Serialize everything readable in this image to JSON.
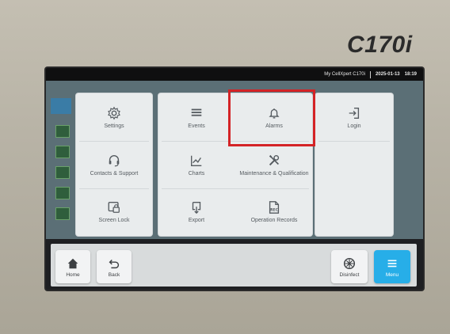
{
  "device": {
    "model": "C170i"
  },
  "statusbar": {
    "device_name": "My CellXpert C170i",
    "date": "2025-01-13",
    "time": "18:19"
  },
  "menu": {
    "settings": "Settings",
    "contacts_support": "Contacts & Support",
    "screen_lock": "Screen Lock",
    "events": "Events",
    "charts": "Charts",
    "export": "Export",
    "alarms": "Alarms",
    "maintenance": "Maintenance & Qualification",
    "operation_records": "Operation Records",
    "login": "Login"
  },
  "bottombar": {
    "home": "Home",
    "back": "Back",
    "disinfect": "Disinfect",
    "menu": "Menu"
  },
  "colors": {
    "accent": "#27aee8",
    "highlight": "#d42326"
  }
}
